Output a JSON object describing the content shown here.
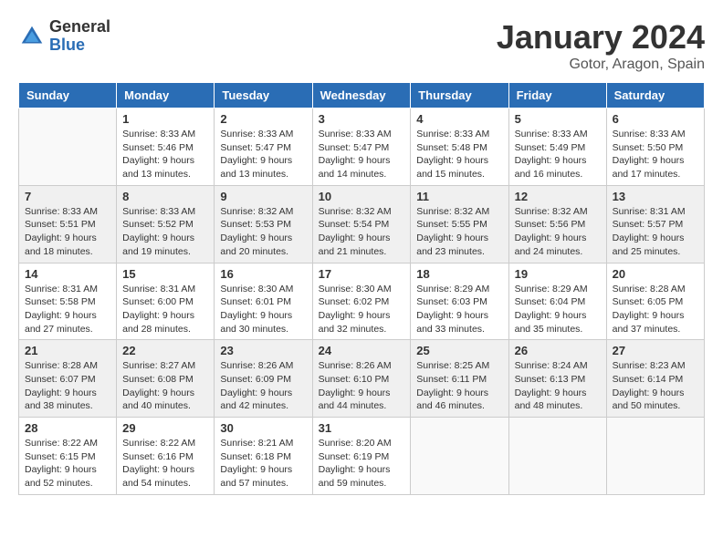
{
  "header": {
    "logo": {
      "general": "General",
      "blue": "Blue"
    },
    "title": "January 2024",
    "subtitle": "Gotor, Aragon, Spain"
  },
  "calendar": {
    "days_of_week": [
      "Sunday",
      "Monday",
      "Tuesday",
      "Wednesday",
      "Thursday",
      "Friday",
      "Saturday"
    ],
    "weeks": [
      [
        {
          "day": "",
          "sunrise": "",
          "sunset": "",
          "daylight": ""
        },
        {
          "day": "1",
          "sunrise": "Sunrise: 8:33 AM",
          "sunset": "Sunset: 5:46 PM",
          "daylight": "Daylight: 9 hours and 13 minutes."
        },
        {
          "day": "2",
          "sunrise": "Sunrise: 8:33 AM",
          "sunset": "Sunset: 5:47 PM",
          "daylight": "Daylight: 9 hours and 13 minutes."
        },
        {
          "day": "3",
          "sunrise": "Sunrise: 8:33 AM",
          "sunset": "Sunset: 5:47 PM",
          "daylight": "Daylight: 9 hours and 14 minutes."
        },
        {
          "day": "4",
          "sunrise": "Sunrise: 8:33 AM",
          "sunset": "Sunset: 5:48 PM",
          "daylight": "Daylight: 9 hours and 15 minutes."
        },
        {
          "day": "5",
          "sunrise": "Sunrise: 8:33 AM",
          "sunset": "Sunset: 5:49 PM",
          "daylight": "Daylight: 9 hours and 16 minutes."
        },
        {
          "day": "6",
          "sunrise": "Sunrise: 8:33 AM",
          "sunset": "Sunset: 5:50 PM",
          "daylight": "Daylight: 9 hours and 17 minutes."
        }
      ],
      [
        {
          "day": "7",
          "sunrise": "Sunrise: 8:33 AM",
          "sunset": "Sunset: 5:51 PM",
          "daylight": "Daylight: 9 hours and 18 minutes."
        },
        {
          "day": "8",
          "sunrise": "Sunrise: 8:33 AM",
          "sunset": "Sunset: 5:52 PM",
          "daylight": "Daylight: 9 hours and 19 minutes."
        },
        {
          "day": "9",
          "sunrise": "Sunrise: 8:32 AM",
          "sunset": "Sunset: 5:53 PM",
          "daylight": "Daylight: 9 hours and 20 minutes."
        },
        {
          "day": "10",
          "sunrise": "Sunrise: 8:32 AM",
          "sunset": "Sunset: 5:54 PM",
          "daylight": "Daylight: 9 hours and 21 minutes."
        },
        {
          "day": "11",
          "sunrise": "Sunrise: 8:32 AM",
          "sunset": "Sunset: 5:55 PM",
          "daylight": "Daylight: 9 hours and 23 minutes."
        },
        {
          "day": "12",
          "sunrise": "Sunrise: 8:32 AM",
          "sunset": "Sunset: 5:56 PM",
          "daylight": "Daylight: 9 hours and 24 minutes."
        },
        {
          "day": "13",
          "sunrise": "Sunrise: 8:31 AM",
          "sunset": "Sunset: 5:57 PM",
          "daylight": "Daylight: 9 hours and 25 minutes."
        }
      ],
      [
        {
          "day": "14",
          "sunrise": "Sunrise: 8:31 AM",
          "sunset": "Sunset: 5:58 PM",
          "daylight": "Daylight: 9 hours and 27 minutes."
        },
        {
          "day": "15",
          "sunrise": "Sunrise: 8:31 AM",
          "sunset": "Sunset: 6:00 PM",
          "daylight": "Daylight: 9 hours and 28 minutes."
        },
        {
          "day": "16",
          "sunrise": "Sunrise: 8:30 AM",
          "sunset": "Sunset: 6:01 PM",
          "daylight": "Daylight: 9 hours and 30 minutes."
        },
        {
          "day": "17",
          "sunrise": "Sunrise: 8:30 AM",
          "sunset": "Sunset: 6:02 PM",
          "daylight": "Daylight: 9 hours and 32 minutes."
        },
        {
          "day": "18",
          "sunrise": "Sunrise: 8:29 AM",
          "sunset": "Sunset: 6:03 PM",
          "daylight": "Daylight: 9 hours and 33 minutes."
        },
        {
          "day": "19",
          "sunrise": "Sunrise: 8:29 AM",
          "sunset": "Sunset: 6:04 PM",
          "daylight": "Daylight: 9 hours and 35 minutes."
        },
        {
          "day": "20",
          "sunrise": "Sunrise: 8:28 AM",
          "sunset": "Sunset: 6:05 PM",
          "daylight": "Daylight: 9 hours and 37 minutes."
        }
      ],
      [
        {
          "day": "21",
          "sunrise": "Sunrise: 8:28 AM",
          "sunset": "Sunset: 6:07 PM",
          "daylight": "Daylight: 9 hours and 38 minutes."
        },
        {
          "day": "22",
          "sunrise": "Sunrise: 8:27 AM",
          "sunset": "Sunset: 6:08 PM",
          "daylight": "Daylight: 9 hours and 40 minutes."
        },
        {
          "day": "23",
          "sunrise": "Sunrise: 8:26 AM",
          "sunset": "Sunset: 6:09 PM",
          "daylight": "Daylight: 9 hours and 42 minutes."
        },
        {
          "day": "24",
          "sunrise": "Sunrise: 8:26 AM",
          "sunset": "Sunset: 6:10 PM",
          "daylight": "Daylight: 9 hours and 44 minutes."
        },
        {
          "day": "25",
          "sunrise": "Sunrise: 8:25 AM",
          "sunset": "Sunset: 6:11 PM",
          "daylight": "Daylight: 9 hours and 46 minutes."
        },
        {
          "day": "26",
          "sunrise": "Sunrise: 8:24 AM",
          "sunset": "Sunset: 6:13 PM",
          "daylight": "Daylight: 9 hours and 48 minutes."
        },
        {
          "day": "27",
          "sunrise": "Sunrise: 8:23 AM",
          "sunset": "Sunset: 6:14 PM",
          "daylight": "Daylight: 9 hours and 50 minutes."
        }
      ],
      [
        {
          "day": "28",
          "sunrise": "Sunrise: 8:22 AM",
          "sunset": "Sunset: 6:15 PM",
          "daylight": "Daylight: 9 hours and 52 minutes."
        },
        {
          "day": "29",
          "sunrise": "Sunrise: 8:22 AM",
          "sunset": "Sunset: 6:16 PM",
          "daylight": "Daylight: 9 hours and 54 minutes."
        },
        {
          "day": "30",
          "sunrise": "Sunrise: 8:21 AM",
          "sunset": "Sunset: 6:18 PM",
          "daylight": "Daylight: 9 hours and 57 minutes."
        },
        {
          "day": "31",
          "sunrise": "Sunrise: 8:20 AM",
          "sunset": "Sunset: 6:19 PM",
          "daylight": "Daylight: 9 hours and 59 minutes."
        },
        {
          "day": "",
          "sunrise": "",
          "sunset": "",
          "daylight": ""
        },
        {
          "day": "",
          "sunrise": "",
          "sunset": "",
          "daylight": ""
        },
        {
          "day": "",
          "sunrise": "",
          "sunset": "",
          "daylight": ""
        }
      ]
    ]
  }
}
